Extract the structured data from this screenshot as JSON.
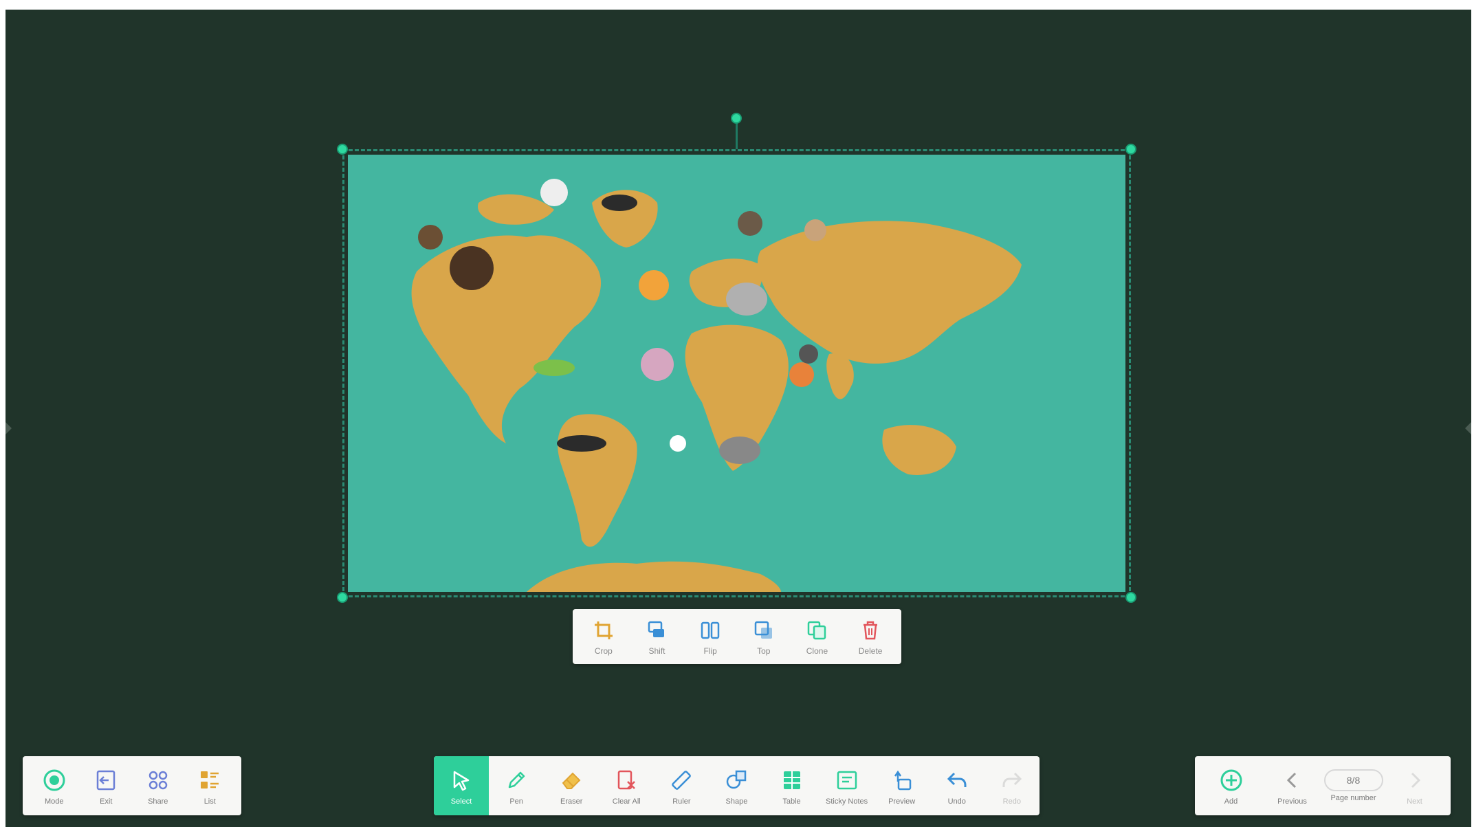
{
  "colors": {
    "board_bg": "#20342a",
    "accent": "#2ecf9a",
    "map_ocean": "#44b6a0",
    "map_land": "#d9a64a"
  },
  "image_toolbar": {
    "items": [
      {
        "label": "Crop",
        "icon": "crop-icon"
      },
      {
        "label": "Shift",
        "icon": "shift-icon"
      },
      {
        "label": "Flip",
        "icon": "flip-icon"
      },
      {
        "label": "Top",
        "icon": "bring-to-top-icon"
      },
      {
        "label": "Clone",
        "icon": "clone-icon"
      },
      {
        "label": "Delete",
        "icon": "trash-icon"
      }
    ]
  },
  "left_toolbar": {
    "items": [
      {
        "label": "Mode",
        "icon": "mode-icon"
      },
      {
        "label": "Exit",
        "icon": "exit-icon"
      },
      {
        "label": "Share",
        "icon": "apps-grid-icon"
      },
      {
        "label": "List",
        "icon": "list-icon"
      }
    ]
  },
  "main_toolbar": {
    "items": [
      {
        "label": "Select",
        "icon": "cursor-icon",
        "active": true
      },
      {
        "label": "Pen",
        "icon": "pen-icon"
      },
      {
        "label": "Eraser",
        "icon": "eraser-icon"
      },
      {
        "label": "Clear All",
        "icon": "clear-all-icon"
      },
      {
        "label": "Ruler",
        "icon": "ruler-icon"
      },
      {
        "label": "Shape",
        "icon": "shape-icon"
      },
      {
        "label": "Table",
        "icon": "table-icon"
      },
      {
        "label": "Sticky Notes",
        "icon": "sticky-note-icon"
      },
      {
        "label": "Preview",
        "icon": "preview-icon"
      },
      {
        "label": "Undo",
        "icon": "undo-icon"
      },
      {
        "label": "Redo",
        "icon": "redo-icon",
        "disabled": true
      }
    ]
  },
  "page_toolbar": {
    "add_label": "Add",
    "previous_label": "Previous",
    "page_number_label": "Page number",
    "page_number": "8/8",
    "next_label": "Next"
  }
}
